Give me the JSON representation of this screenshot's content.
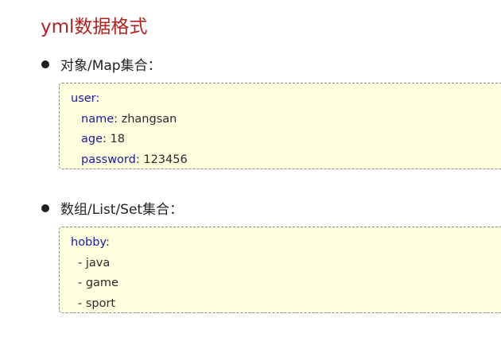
{
  "page": {
    "title": "yml数据格式"
  },
  "sections": [
    {
      "heading": "对象/Map集合：",
      "code": {
        "root_key": "user",
        "root_colon": ":",
        "fields": [
          {
            "key": "name",
            "value": " zhangsan"
          },
          {
            "key": "age",
            "value": " 18"
          },
          {
            "key": "password",
            "value": " 123456"
          }
        ]
      }
    },
    {
      "heading": "数组/List/Set集合：",
      "code": {
        "root_key": "hobby",
        "root_colon": ":",
        "items": [
          "- java",
          "- game",
          "- sport"
        ]
      }
    }
  ],
  "colors": {
    "title": "#b22222",
    "code_key": "#1a1aa6",
    "code_background": "#ffffe0",
    "code_border": "#8a8a8a"
  }
}
